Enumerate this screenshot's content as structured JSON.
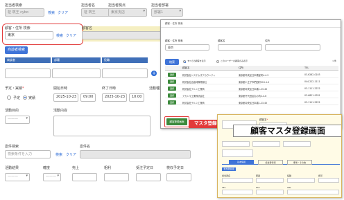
{
  "top_fields": {
    "tanto_kensaku_label": "担当者検索",
    "tanto_kensaku_value": "柾 筑王 cybo",
    "kensaku_link": "検索",
    "clear_link": "クリア",
    "tantosha_mei_label": "担当者名",
    "tantosha_mei_value": "柾 筑王",
    "kyoten_label": "担当者拠点",
    "kyoten_value": "東京支店",
    "busho_label": "担当者部署",
    "busho_value": "部署1"
  },
  "customer": {
    "kensaku_label": "顧客・住所 検索",
    "kensaku_value": "東京",
    "kensaku_link": "検索",
    "clear_link": "クリア",
    "kokyaku_mei_label": "顧客名"
  },
  "shodan": {
    "button": "商談者検索",
    "col1": "商談者",
    "col2": "部署",
    "col3": "役職"
  },
  "yotei": {
    "label": "予定・実績",
    "required": "*",
    "option1": "予定",
    "option2": "実績",
    "start_label": "開始日時",
    "start_date": "2025-10-23",
    "start_time": "09:00",
    "end_label": "終了日時",
    "end_date": "2025-10-23",
    "end_time": "10:00",
    "katsudo_label": "活動種別"
  },
  "katsudo": {
    "mokuteki_label": "活動目的",
    "mokuteki_value": "———",
    "naiyo_label": "活動内容"
  },
  "anken": {
    "kensaku_label": "案件検索",
    "kensaku_placeholder": "検索条件を入力",
    "kensaku_link": "検索",
    "clear_link": "クリア",
    "mei_label": "案件名"
  },
  "bottom": {
    "kekka_label": "活動結果",
    "kekka_value": "———",
    "kakudo_label": "確度",
    "kakudo_value": "———",
    "uriage_label": "売上",
    "arari_label": "粗利",
    "juchu_label": "受注予定日",
    "kensho_label": "検収予定日"
  },
  "popup": {
    "title": "顧客・住所 検索",
    "f1_label": "顧客・住所 検索",
    "f1_value": "東京",
    "f2_label": "顧客名",
    "f3_label": "住所",
    "search_button": "検索",
    "radio1": "すべての顧客を表示",
    "radio2": "このユーザーの顧客のみ表示",
    "count": "1 件",
    "headers": [
      "",
      "顧客名",
      "住所",
      "TEL"
    ],
    "select_label": "選択",
    "rows": [
      {
        "name": "株式会社システムズアカウンティ",
        "addr": "東京都中央区日本橋室町4-4-2",
        "tel": "03-6262-0103"
      },
      {
        "name": "株式会社自由特殊貿易社",
        "addr": "東京都八王子市椚田町519-1-2",
        "tel": "044-222-1111"
      },
      {
        "name": "株式会社テルシ工業商",
        "addr": "東京都中央区日本橋1-23-45",
        "tel": "03-1111-2222"
      },
      {
        "name": "アカシマ工業株式会社",
        "addr": "東京都千代田区丸の内2-4-6",
        "tel": "03-6821-9761"
      },
      {
        "name": "株式会社テルシ工業商",
        "addr": "東京都中央区日本橋1-23-45",
        "tel": "03-1111-2222"
      }
    ],
    "register_button": "顧客登録画面"
  },
  "annotation": {
    "arrow_label": "マスタ登録へ",
    "big_label": "顧客マスタ登録画面"
  },
  "popup2": {
    "f_label1": "顧客名",
    "required": "*",
    "tabs": [
      "基本情報",
      "担当者情報",
      "備考・その他"
    ],
    "section_title": "担当者情報",
    "c1": "担当者名",
    "c2": "部署",
    "c3": "役職",
    "c4": "携帯",
    "tel_label": "TEL",
    "fax_label": "FAX",
    "url_label": "URL"
  },
  "colors": {
    "accent_blue": "#3f74d8",
    "table_header": "#3f6fb8",
    "highlight_red": "#e23a3a",
    "register_green": "#3c8a3c",
    "popup_bg": "#fffbe6",
    "yellow_tint": "#f5efc2"
  }
}
